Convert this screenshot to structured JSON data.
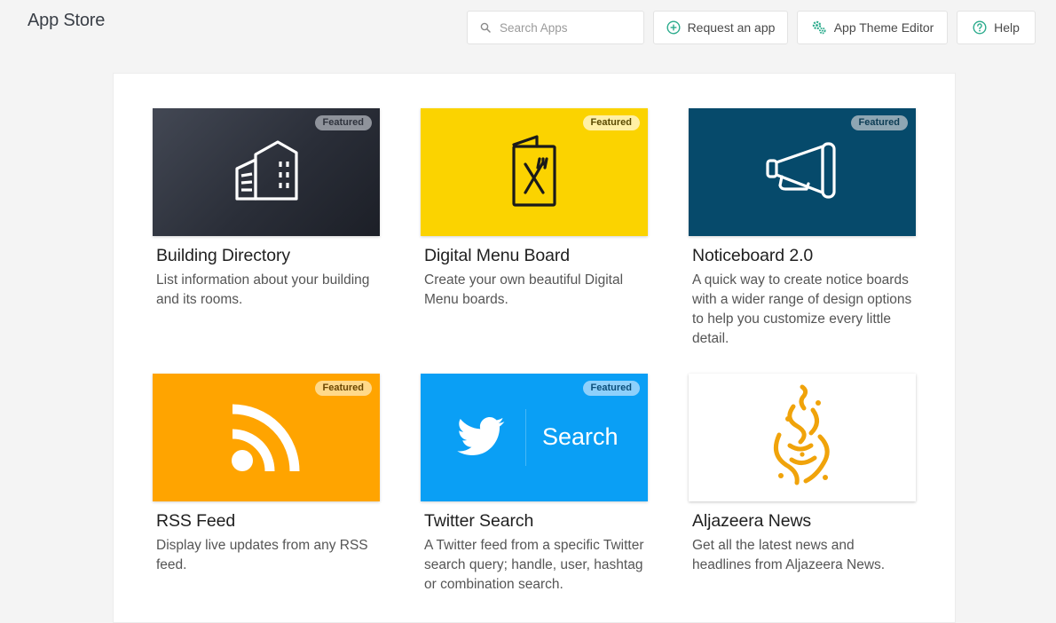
{
  "header": {
    "title": "App Store",
    "search_placeholder": "Search Apps",
    "request_label": "Request an app",
    "theme_label": "App Theme Editor",
    "help_label": "Help",
    "accent": "#2bab8c"
  },
  "apps": [
    {
      "title": "Building Directory",
      "desc": "List information about your building and its rooms.",
      "badge": "Featured",
      "icon": "building-icon",
      "bg": "#2f333d"
    },
    {
      "title": "Digital Menu Board",
      "desc": "Create your own beautiful Digital Menu boards.",
      "badge": "Featured",
      "icon": "menu-fork-knife-icon",
      "bg": "#fbd300"
    },
    {
      "title": "Noticeboard 2.0",
      "desc": "A quick way to create notice boards with a wider range of design options to help you customize every little detail.",
      "badge": "Featured",
      "icon": "megaphone-icon",
      "bg": "#064a6b"
    },
    {
      "title": "RSS Feed",
      "desc": "Display live updates from any RSS feed.",
      "badge": "Featured",
      "icon": "rss-icon",
      "bg": "#ffa400"
    },
    {
      "title": "Twitter Search",
      "desc": "A Twitter feed from a specific Twitter search query; handle, user, hashtag or combination search.",
      "badge": "Featured",
      "icon": "twitter-bird-icon",
      "bg": "#0a9ff5",
      "thumb_text": "Search"
    },
    {
      "title": "Aljazeera News",
      "desc": "Get all the latest news and headlines from Aljazeera News.",
      "icon": "aljazeera-logo-icon",
      "bg": "#ffffff"
    }
  ]
}
